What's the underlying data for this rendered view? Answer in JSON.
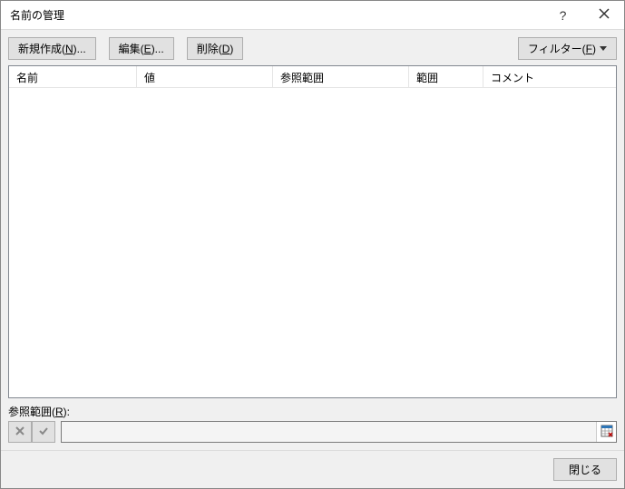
{
  "title": "名前の管理",
  "toolbar": {
    "new_pre": "新規作成(",
    "new_key": "N",
    "new_post": ")...",
    "edit_pre": "編集(",
    "edit_key": "E",
    "edit_post": ")...",
    "delete_pre": "削除(",
    "delete_key": "D",
    "delete_post": ")",
    "filter_pre": "フィルター(",
    "filter_key": "F",
    "filter_post": ")"
  },
  "columns": {
    "name": "名前",
    "value": "値",
    "refers": "参照範囲",
    "scope": "範囲",
    "comment": "コメント"
  },
  "refersto": {
    "label_pre": "参照範囲(",
    "label_key": "R",
    "label_post": "):",
    "value": ""
  },
  "footer": {
    "close": "閉じる"
  }
}
